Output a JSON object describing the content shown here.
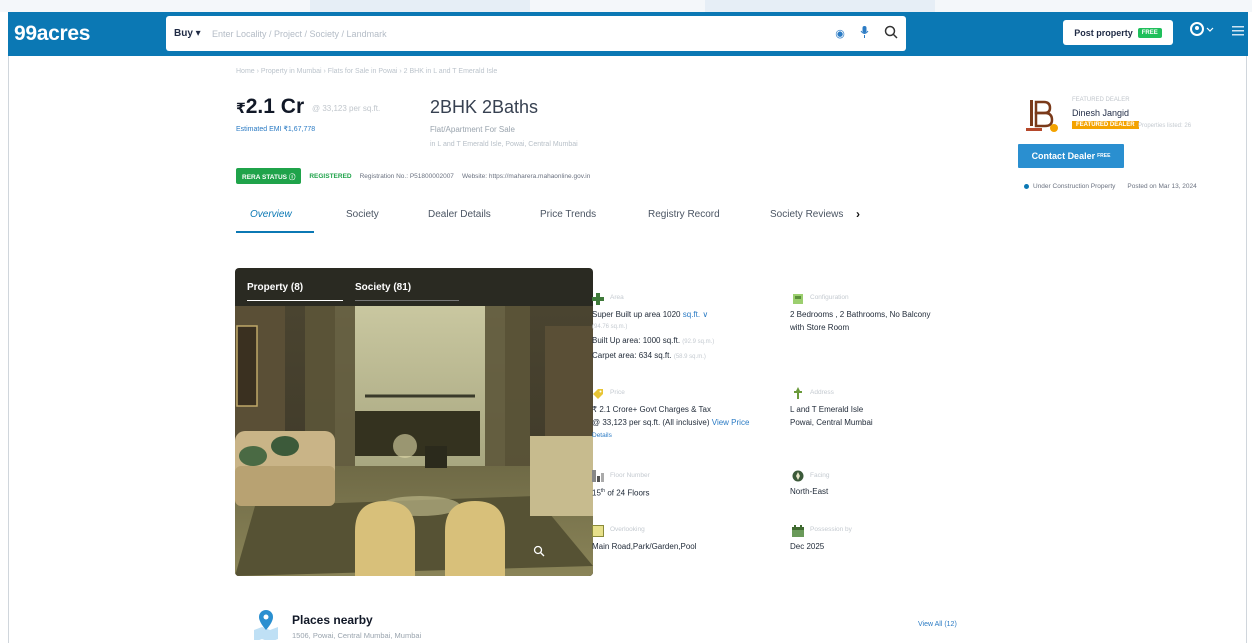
{
  "header": {
    "logo": "99acres",
    "buy_label": "Buy ▾",
    "search_placeholder": "Enter Locality / Project / Society / Landmark",
    "post_property_label": "Post property",
    "post_property_badge": "FREE",
    "user_icon": "user-icon",
    "menu_icon": "hamburger-icon",
    "brand_color": "#0b78b4"
  },
  "breadcrumb": "Home › Property in Mumbai › Flats for Sale in Powai › 2 BHK in L and T Emerald Isle",
  "listing": {
    "price": "2.1 Cr",
    "price_per_sqft": "@ 33,123 per sq.ft.",
    "emi": "Estimated EMI ₹1,67,778",
    "title": "2BHK 2Baths",
    "property_type": "Flat/Apartment For Sale",
    "address": "in L and T Emerald Isle, Powai, Central Mumbai"
  },
  "rera": {
    "badge": "RERA STATUS",
    "registered": "REGISTERED",
    "registration_no": "Registration No.: P51800002007",
    "website": "Website: https://maharera.mahaonline.gov.in"
  },
  "tabs": [
    "Overview",
    "Society",
    "Dealer Details",
    "Price Trends",
    "Registry Record",
    "Society Reviews"
  ],
  "dealer": {
    "caption": "FEATURED DEALER",
    "name": "Dinesh Jangid",
    "tag": "FEATURED DEALER",
    "extra": "Properties listed: 26",
    "contact_label": "Contact Dealer",
    "contact_badge": "FREE",
    "status": "Under Construction Property",
    "posted": "Posted on Mar 13, 2024"
  },
  "gallery": {
    "tab_property": "Property (8)",
    "tab_society": "Society (81)"
  },
  "details": {
    "area_caption": "Area",
    "area_super": "Super Built up area 1020",
    "area_unit": "sq.ft. ∨",
    "area_super_m": "(94.76 sq.m.)",
    "built_up": "Built Up area: 1000 sq.ft.",
    "built_up_m": "(92.9 sq.m.)",
    "carpet": "Carpet area: 634 sq.ft.",
    "carpet_m": "(58.9 sq.m.)",
    "config_caption": "Configuration",
    "config": "2 Bedrooms , 2 Bathrooms, No Balcony",
    "config2": "with Store Room",
    "price_caption": "Price",
    "price_line1": "₹ 2.1 Crore+ Govt Charges & Tax",
    "price_line2": "@ 33,123 per sq.ft. (All inclusive)",
    "price_link1": "View Price",
    "price_link2": "Details",
    "address_caption": "Address",
    "address_line1": "L and T Emerald Isle",
    "address_line2": "Powai, Central Mumbai",
    "floor_caption": "Floor Number",
    "floor": "15",
    "floor_sup": "th",
    "floor_total": "of 24 Floors",
    "facing_caption": "Facing",
    "facing": "North-East",
    "overlooking_caption": "Overlooking",
    "overlooking": "Main Road,Park/Garden,Pool",
    "possession_caption": "Possession by",
    "possession": "Dec 2025"
  },
  "places": {
    "title": "Places nearby",
    "subtitle": "1506, Powai, Central Mumbai, Mumbai",
    "view_all": "View All (12)"
  }
}
